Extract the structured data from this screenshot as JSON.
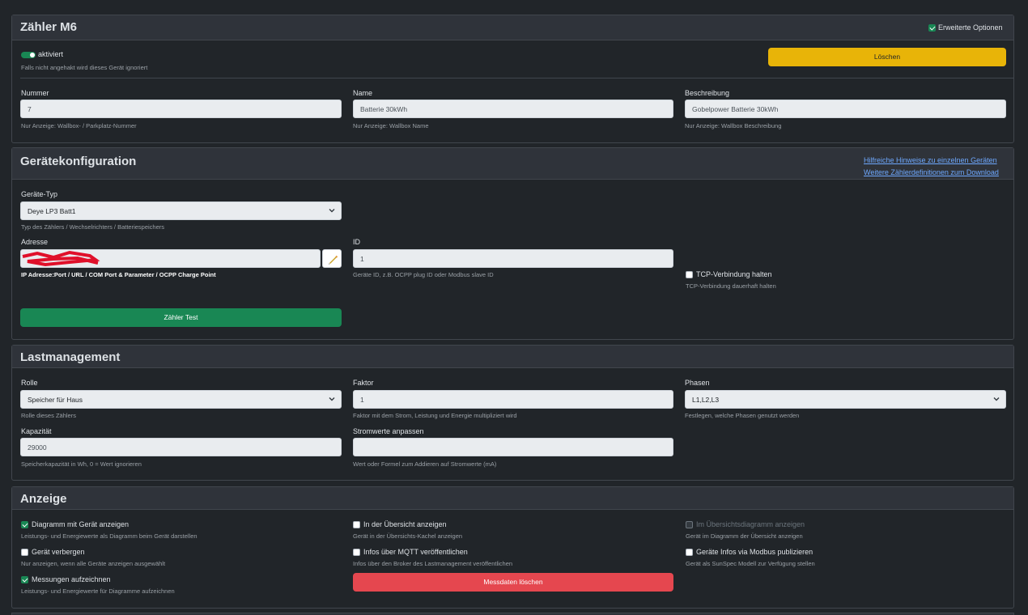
{
  "meter": {
    "title": "Zähler M6",
    "advanced_label": "Erweiterte Optionen",
    "active_label": "aktiviert",
    "active_hint": "Falls nicht angehakt wird dieses Gerät ignoriert",
    "delete_label": "Löschen",
    "number": {
      "label": "Nummer",
      "value": "7",
      "hint": "Nur Anzeige: Wallbox- / Parkplatz-Nummer"
    },
    "name": {
      "label": "Name",
      "value": "Batterie 30kWh",
      "hint": "Nur Anzeige: Wallbox Name"
    },
    "description": {
      "label": "Beschreibung",
      "value": "Gobelpower Batterie 30kWh",
      "hint": "Nur Anzeige: Wallbox Beschreibung"
    }
  },
  "device_config": {
    "title": "Gerätekonfiguration",
    "link_hints": "Hilfreiche Hinweise zu einzelnen Geräten",
    "link_download": "Weitere Zählerdefinitionen zum Download",
    "type": {
      "label": "Geräte-Typ",
      "value": "Deye LP3 Batt1",
      "hint": "Typ des Zählers / Wechselrichters / Batteriespeichers"
    },
    "address": {
      "label": "Adresse",
      "hint": "IP Adresse:Port / URL / COM Port & Parameter / OCPP Charge Point"
    },
    "id": {
      "label": "ID",
      "value": "1",
      "hint": "Geräte ID, z.B. OCPP plug ID oder Modbus slave ID"
    },
    "tcp": {
      "label": "TCP-Verbindung halten",
      "hint": "TCP-Verbindung dauerhaft halten"
    },
    "test_label": "Zähler Test"
  },
  "load": {
    "title": "Lastmanagement",
    "role": {
      "label": "Rolle",
      "value": "Speicher für Haus",
      "hint": "Rolle dieses Zählers"
    },
    "factor": {
      "label": "Faktor",
      "value": "1",
      "hint": "Faktor mit dem Strom, Leistung und Energie multipliziert wird"
    },
    "phases": {
      "label": "Phasen",
      "value": "L1,L2,L3",
      "hint": "Festlegen, welche Phasen genutzt werden"
    },
    "capacity": {
      "label": "Kapazität",
      "value": "29000",
      "hint": "Speicherkapazität in Wh, 0 = Wert ignorieren"
    },
    "current_adjust": {
      "label": "Stromwerte anpassen",
      "value": "",
      "hint": "Wert oder Formel zum Addieren auf Stromwerte (mA)"
    }
  },
  "display": {
    "title": "Anzeige",
    "diagram": {
      "label": "Diagramm mit Gerät anzeigen",
      "hint": "Leistungs- und Energiewerte als Diagramm beim Gerät darstellen"
    },
    "overview": {
      "label": "In der Übersicht anzeigen",
      "hint": "Gerät in der Übersichts-Kachel anzeigen"
    },
    "overview_diagram": {
      "label": "Im Übersichtsdiagramm anzeigen",
      "hint": "Gerät im Diagramm der Übersicht anzeigen"
    },
    "hide": {
      "label": "Gerät verbergen",
      "hint": "Nur anzeigen, wenn alle Geräte anzeigen ausgewählt"
    },
    "mqtt": {
      "label": "Infos über MQTT veröffentlichen",
      "hint": "Infos über den Broker des Lastmanagement veröffentlichen"
    },
    "modbus": {
      "label": "Geräte Infos via Modbus publizieren",
      "hint": "Gerät als SunSpec Modell zur Verfügung stellen"
    },
    "record": {
      "label": "Messungen aufzeichnen",
      "hint": "Leistungs- und Energiewerte für Diagramme aufzeichnen"
    },
    "delete_data_label": "Messdaten löschen"
  },
  "colors": {
    "accent_green": "#198754",
    "warning": "#e8b408",
    "danger": "#e5474f",
    "link": "#6ea8fe"
  }
}
